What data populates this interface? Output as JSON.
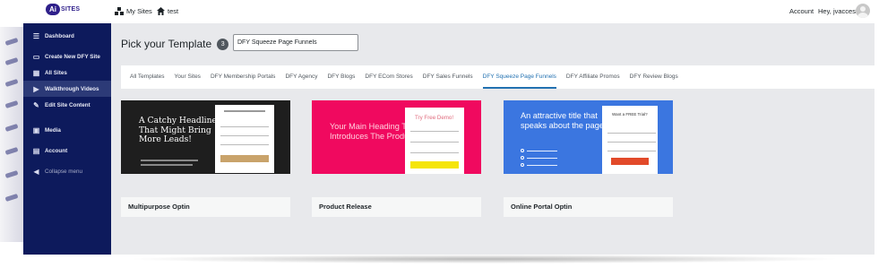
{
  "adminbar": {
    "logo_badge": "Ai",
    "logo_text": "SITES",
    "my_sites": "My Sites",
    "site_name": "test",
    "account": "Account",
    "greeting": "Hey, jvaccess"
  },
  "sidebar": {
    "items": [
      {
        "label": "Dashboard",
        "icon": "menu-icon"
      },
      {
        "label": "Create New DFY Site",
        "icon": "window-icon"
      },
      {
        "label": "All Sites",
        "icon": "grid-icon"
      },
      {
        "label": "Walkthrough Videos",
        "icon": "play-icon"
      },
      {
        "label": "Edit Site Content",
        "icon": "wrench-icon"
      },
      {
        "label": "Media",
        "icon": "media-icon"
      },
      {
        "label": "Account",
        "icon": "account-icon"
      },
      {
        "label": "Collapse menu",
        "icon": "collapse-icon"
      }
    ]
  },
  "main": {
    "title": "Pick your Template",
    "count": "3",
    "search_value": "DFY Squeeze Page Funnels",
    "tabs": [
      "All Templates",
      "Your Sites",
      "DFY Membership Portals",
      "DFY Agency",
      "DFY Blogs",
      "DFY ECom Stores",
      "DFY Sales Funnels",
      "DFY Squeeze Page Funnels",
      "DFY Affiliate Promos",
      "DFY Review Blogs"
    ],
    "active_tab": "DFY Squeeze Page Funnels",
    "templates": [
      {
        "name": "Multipurpose Optin",
        "headline": "A Catchy Headline That Might Bring More Leads!",
        "bg": "#1e1e1e",
        "button_color": "#c9a36b"
      },
      {
        "name": "Product Release",
        "headline": "Your Main Heading That Introduces The Product!",
        "form_title": "Try Free Demo!",
        "bg": "#f0095f",
        "button_color": "#f5e50a"
      },
      {
        "name": "Online Portal Optin",
        "headline": "An attractive title that speaks about the page",
        "form_title": "Want a FREE Trial?",
        "bg": "#3b76e0",
        "button_color": "#e24a2a"
      }
    ]
  },
  "colors": {
    "sidebar_bg": "#0d1a5c",
    "active_tab": "#2271b1",
    "logo": "#2e1f8a"
  }
}
